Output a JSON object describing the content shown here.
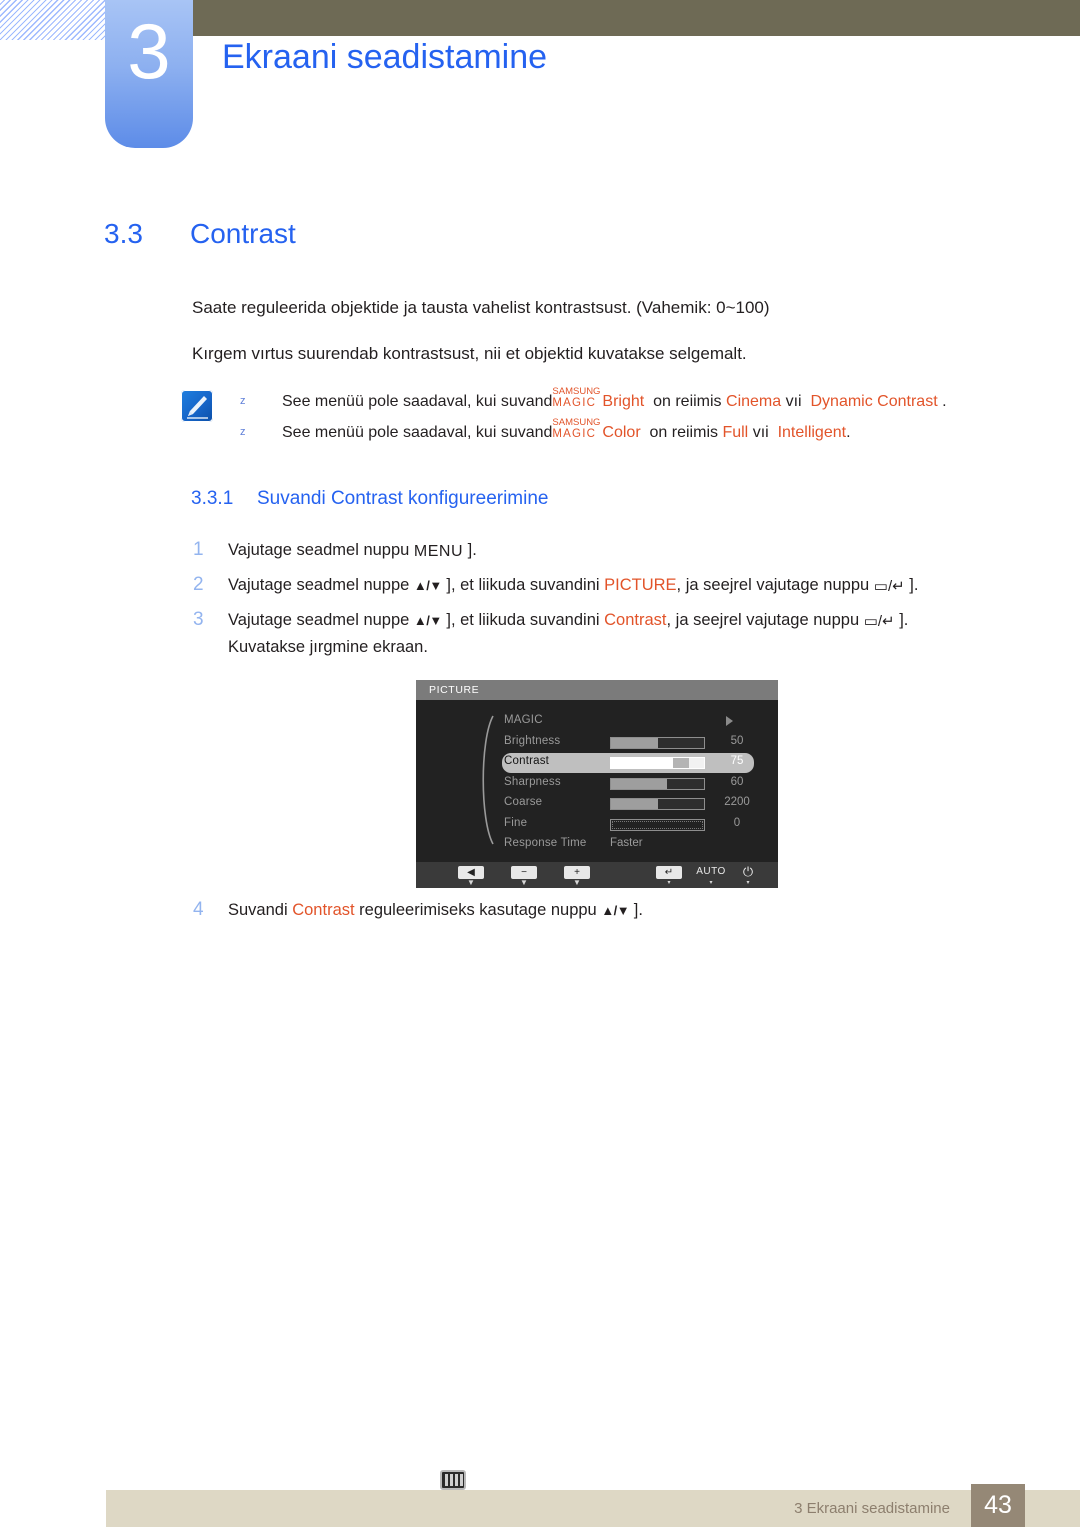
{
  "header": {
    "chapter_number": "3",
    "chapter_title": "Ekraani seadistamine"
  },
  "section": {
    "number": "3.3",
    "title": "Contrast"
  },
  "body": {
    "paragraph_1": "Saate reguleerida objektide ja tausta vahelist kontrastsust. (Vahemik: 0~100)",
    "paragraph_2": "Kırgem vırtus suurendab  kontrastsust, nii et objektid kuvatakse selgemalt."
  },
  "notes": {
    "icon_name": "note-pencil-icon",
    "items": [
      {
        "bullet": "z",
        "text_before": "See menüü pole saadaval, kui suvand",
        "magic_top": "SAMSUNG",
        "magic_bottom": "MAGIC",
        "mode_label": "Bright",
        "text_mid": "on reiimis",
        "value_1": "Cinema",
        "conj": "vıi",
        "value_2": "Dynamic Contrast",
        "text_end": "."
      },
      {
        "bullet": "z",
        "text_before": "See menüü pole saadaval, kui suvand",
        "magic_top": "SAMSUNG",
        "magic_bottom": "MAGIC",
        "mode_label": "Color",
        "text_mid": "on reiimis",
        "value_1": "Full",
        "conj": "vıi",
        "value_2": "Intelligent",
        "text_end": "."
      }
    ]
  },
  "subsection": {
    "number": "3.3.1",
    "title": "Suvandi Contrast konfigureerimine"
  },
  "steps": [
    {
      "num": "1",
      "parts": [
        {
          "t": "Vajutage seadmel nuppu "
        },
        {
          "t": "MENU",
          "style": "key"
        },
        {
          "t": " ]."
        }
      ]
    },
    {
      "num": "2",
      "parts": [
        {
          "t": "Vajutage seadmel nuppe "
        },
        {
          "t": "▲/▼",
          "style": "updown"
        },
        {
          "t": " ], et liikuda suvandini "
        },
        {
          "t": "PICTURE",
          "style": "orange"
        },
        {
          "t": ", ja seejrel vajutage nuppu "
        },
        {
          "t": "▭/↵",
          "style": "enter"
        },
        {
          "t": " ]."
        }
      ]
    },
    {
      "num": "3",
      "parts": [
        {
          "t": "Vajutage seadmel nuppe "
        },
        {
          "t": "▲/▼",
          "style": "updown"
        },
        {
          "t": " ], et liikuda suvandini "
        },
        {
          "t": "Contrast",
          "style": "orange"
        },
        {
          "t": ", ja seejrel vajutage nuppu "
        },
        {
          "t": "▭/↵",
          "style": "enter"
        },
        {
          "t": " ]."
        }
      ],
      "continuation": "Kuvatakse jırgmine ekraan."
    },
    {
      "num": "4",
      "parts": [
        {
          "t": "Suvandi "
        },
        {
          "t": "Contrast",
          "style": "orange"
        },
        {
          "t": " reguleerimiseks kasutage nuppu "
        },
        {
          "t": "▲/▼",
          "style": "updown"
        },
        {
          "t": " ]."
        }
      ]
    }
  ],
  "osd": {
    "title": "PICTURE",
    "category_icon": "picture-bars-icon",
    "rows": [
      {
        "label": "MAGIC",
        "type": "arrow",
        "value": "",
        "fill": 0,
        "selected": false
      },
      {
        "label": "Brightness",
        "type": "slider",
        "value": "50",
        "fill": 50,
        "selected": false
      },
      {
        "label": "Contrast",
        "type": "slider",
        "value": "75",
        "fill": 75,
        "selected": true
      },
      {
        "label": "Sharpness",
        "type": "slider",
        "value": "60",
        "fill": 60,
        "selected": false
      },
      {
        "label": "Coarse",
        "type": "slider",
        "value": "2200",
        "fill": 50,
        "selected": false
      },
      {
        "label": "Fine",
        "type": "empty",
        "value": "0",
        "fill": 0,
        "selected": false
      },
      {
        "label": "Response Time",
        "type": "text",
        "value": "Faster",
        "fill": 0,
        "selected": false
      }
    ],
    "footer": {
      "back_icon": "◀",
      "minus_icon": "−",
      "plus_icon": "+",
      "enter_icon": "↵",
      "auto_label": "AUTO",
      "power_icon": "⏻"
    }
  },
  "footer": {
    "text": "3 Ekraani seadistamine",
    "page": "43"
  },
  "colors": {
    "accent_blue": "#2562f0",
    "chapter_tab": "#8db0f0",
    "header_bar": "#6e6a55",
    "orange": "#e2542a",
    "footer_bar": "#ded8c5",
    "footer_page": "#958876"
  }
}
